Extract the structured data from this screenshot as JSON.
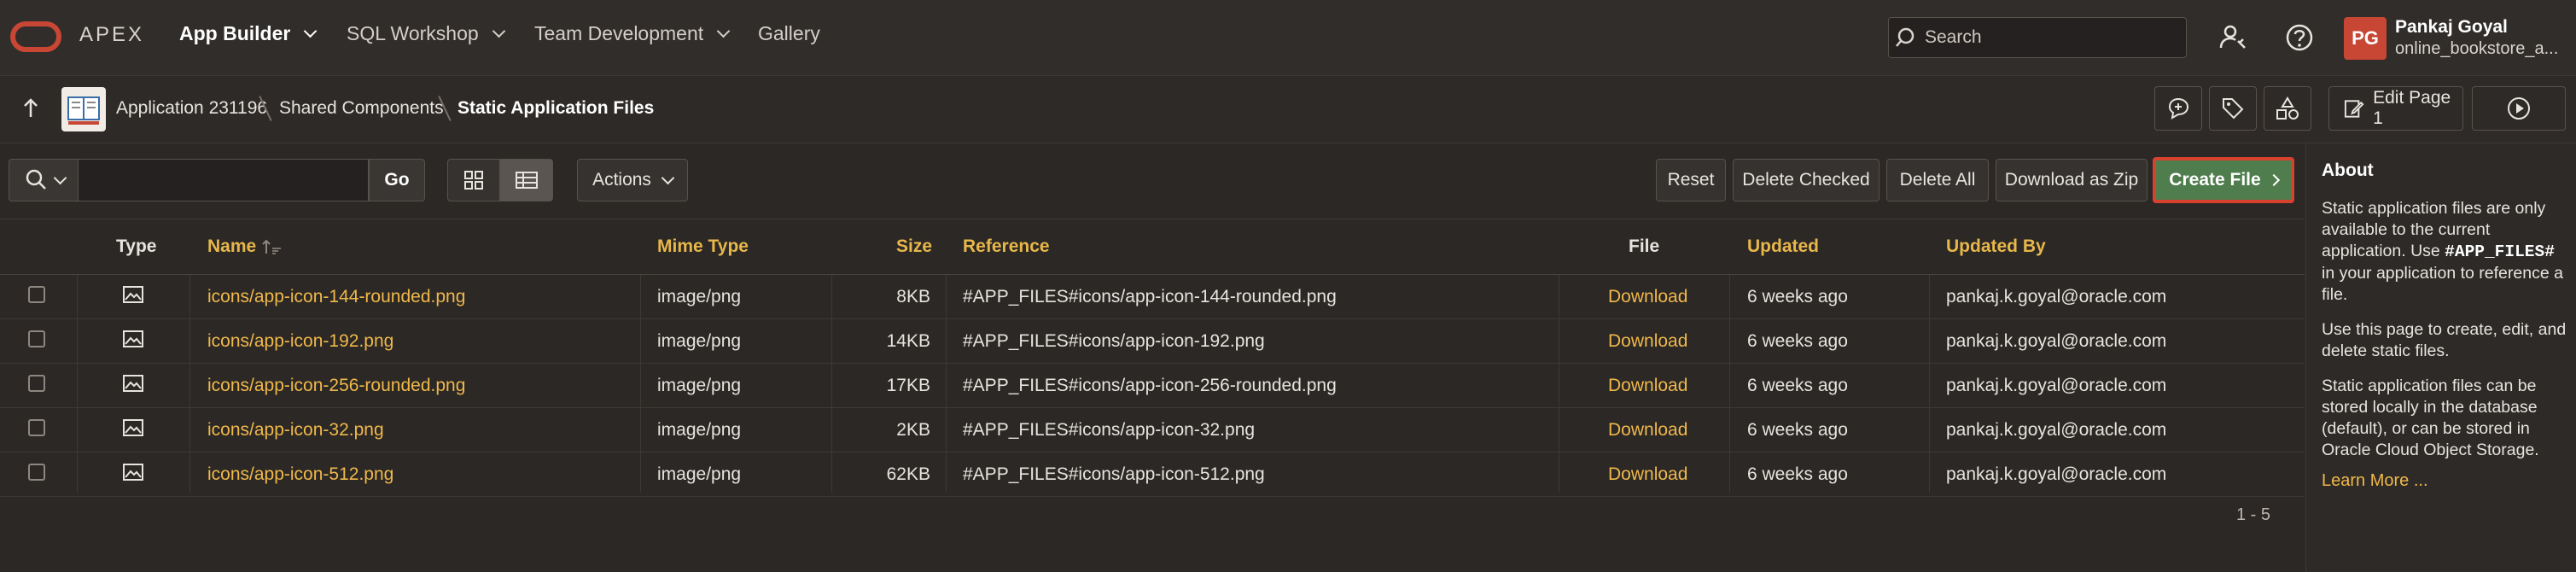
{
  "brand": {
    "name": "APEX",
    "logo_color": "#c74634"
  },
  "nav": [
    {
      "label": "App Builder",
      "active": true
    },
    {
      "label": "SQL Workshop",
      "active": false
    },
    {
      "label": "Team Development",
      "active": false
    },
    {
      "label": "Gallery",
      "active": false
    }
  ],
  "search": {
    "placeholder": "Search"
  },
  "user": {
    "initials": "PG",
    "name": "Pankaj Goyal",
    "workspace": "online_bookstore_a..."
  },
  "breadcrumb": {
    "items": [
      "Application 231196",
      "Shared Components",
      "Static Application Files"
    ]
  },
  "page_toolbar": {
    "edit_page_label": "Edit Page 1"
  },
  "report_toolbar": {
    "go_label": "Go",
    "actions_label": "Actions",
    "reset_label": "Reset",
    "delete_checked_label": "Delete Checked",
    "delete_all_label": "Delete All",
    "download_zip_label": "Download as Zip",
    "create_file_label": "Create File",
    "create_file_color": "#4f7d4d"
  },
  "table": {
    "headers": {
      "type": "Type",
      "name": "Name",
      "mime": "Mime Type",
      "size": "Size",
      "reference": "Reference",
      "file": "File",
      "updated": "Updated",
      "updated_by": "Updated By"
    },
    "rows": [
      {
        "name": "icons/app-icon-144-rounded.png",
        "mime": "image/png",
        "size": "8KB",
        "reference": "#APP_FILES#icons/app-icon-144-rounded.png",
        "file": "Download",
        "updated": "6 weeks ago",
        "updated_by": "pankaj.k.goyal@oracle.com"
      },
      {
        "name": "icons/app-icon-192.png",
        "mime": "image/png",
        "size": "14KB",
        "reference": "#APP_FILES#icons/app-icon-192.png",
        "file": "Download",
        "updated": "6 weeks ago",
        "updated_by": "pankaj.k.goyal@oracle.com"
      },
      {
        "name": "icons/app-icon-256-rounded.png",
        "mime": "image/png",
        "size": "17KB",
        "reference": "#APP_FILES#icons/app-icon-256-rounded.png",
        "file": "Download",
        "updated": "6 weeks ago",
        "updated_by": "pankaj.k.goyal@oracle.com"
      },
      {
        "name": "icons/app-icon-32.png",
        "mime": "image/png",
        "size": "2KB",
        "reference": "#APP_FILES#icons/app-icon-32.png",
        "file": "Download",
        "updated": "6 weeks ago",
        "updated_by": "pankaj.k.goyal@oracle.com"
      },
      {
        "name": "icons/app-icon-512.png",
        "mime": "image/png",
        "size": "62KB",
        "reference": "#APP_FILES#icons/app-icon-512.png",
        "file": "Download",
        "updated": "6 weeks ago",
        "updated_by": "pankaj.k.goyal@oracle.com"
      }
    ],
    "pagination": "1 - 5"
  },
  "about": {
    "title": "About",
    "p1_a": "Static application files are only available to the current application. Use ",
    "p1_code": "#APP_FILES#",
    "p1_b": " in your application to reference a file.",
    "p2": "Use this page to create, edit, and delete static files.",
    "p3": "Static application files can be stored locally in the database (default), or can be stored in Oracle Cloud Object Storage.",
    "learn_more": "Learn More ..."
  },
  "colors": {
    "accent": "#f0b84a",
    "brand": "#c74634",
    "highlight_border": "#d9412f"
  }
}
